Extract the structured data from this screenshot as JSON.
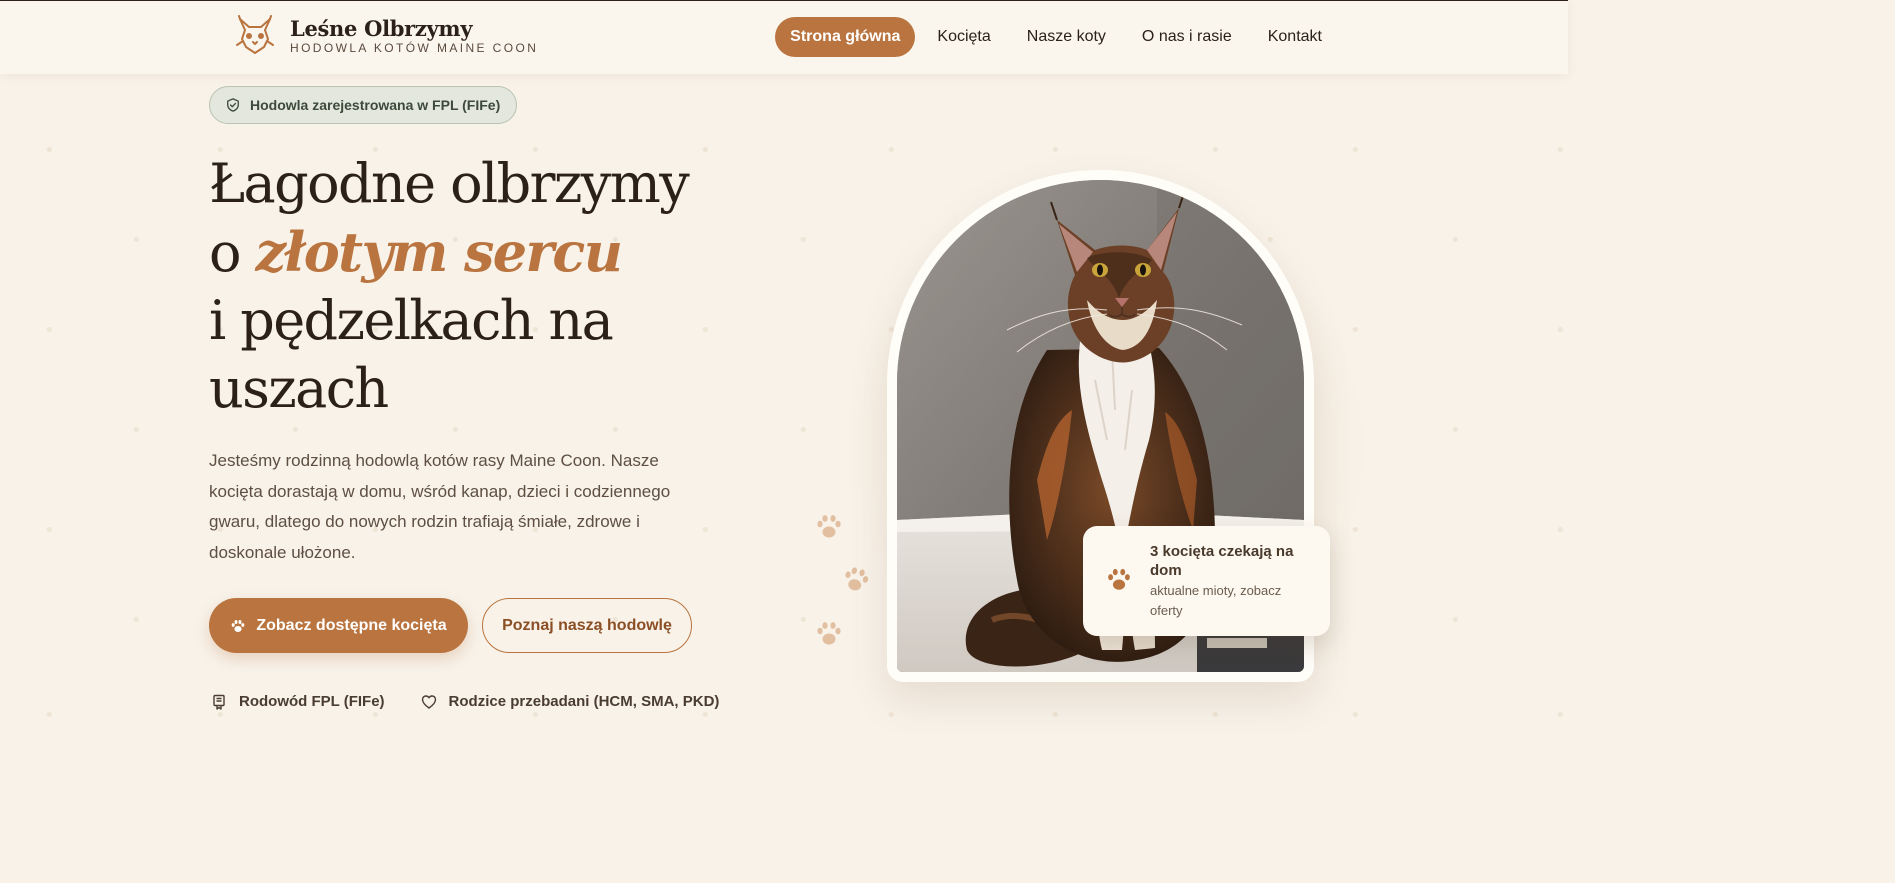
{
  "brand": {
    "name": "Leśne Olbrzymy",
    "tagline": "HODOWLA KOTÓW MAINE COON",
    "logo_icon": "lynx-head-icon"
  },
  "nav": {
    "items": [
      {
        "label": "Strona główna",
        "active": true
      },
      {
        "label": "Kocięta",
        "active": false
      },
      {
        "label": "Nasze koty",
        "active": false
      },
      {
        "label": "O nas i rasie",
        "active": false
      },
      {
        "label": "Kontakt",
        "active": false
      }
    ]
  },
  "hero": {
    "badge": "Hodowla zarejestrowana w FPL (FIFe)",
    "headline": {
      "line1": "Łagodne olbrzymy",
      "line2_prefix": "o ",
      "line2_accent": "złotym sercu",
      "line3": "i pędzelkach na uszach"
    },
    "lead": "Jesteśmy rodzinną hodowlą kotów rasy Maine Coon. Nasze kocięta dorastają w domu, wśród kanap, dzieci i codziennego gwaru, dlatego do nowych rodzin trafiają śmiałe, zdrowe i doskonale ułożone.",
    "primary_button": "Zobacz dostępne kocięta",
    "secondary_button": "Poznaj naszą hodowlę",
    "features": [
      {
        "icon": "certificate-icon",
        "label": "Rodowód FPL (FIFe)"
      },
      {
        "icon": "heart-icon",
        "label": "Rodzice przebadani (HCM, SMA, PKD)"
      }
    ]
  },
  "info_card": {
    "title": "3 kocięta czekają na dom",
    "subtitle": "aktualne mioty, zobacz oferty"
  },
  "colors": {
    "accent": "#b9743f",
    "background": "#f8f2e9",
    "text": "#2c2119",
    "badge_bg": "#e3e7dd"
  }
}
